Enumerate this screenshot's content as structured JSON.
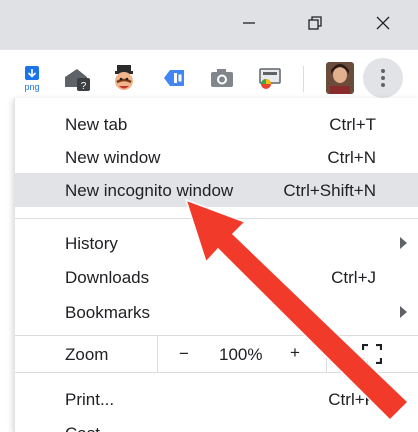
{
  "window_controls": {
    "minimize_icon": "minimize-icon",
    "restore_icon": "restore-icon",
    "close_icon": "close-icon"
  },
  "toolbar": {
    "extensions": [
      {
        "name": "png-download-extension",
        "caption": "png"
      },
      {
        "name": "mail-help-extension",
        "caption": "?"
      },
      {
        "name": "mascot-extension",
        "caption": ""
      },
      {
        "name": "tag-extension",
        "caption": ""
      },
      {
        "name": "camera-extension",
        "caption": ""
      },
      {
        "name": "screen-cast-extension",
        "caption": ""
      }
    ],
    "profile_icon": "profile-avatar",
    "menu_icon": "more-vertical-icon"
  },
  "menu": {
    "new_tab": {
      "label": "New tab",
      "shortcut": "Ctrl+T"
    },
    "new_window": {
      "label": "New window",
      "shortcut": "Ctrl+N"
    },
    "new_incognito": {
      "label": "New incognito window",
      "shortcut": "Ctrl+Shift+N"
    },
    "history": {
      "label": "History"
    },
    "downloads": {
      "label": "Downloads",
      "shortcut": "Ctrl+J"
    },
    "bookmarks": {
      "label": "Bookmarks"
    },
    "zoom": {
      "label": "Zoom",
      "minus": "−",
      "level": "100%",
      "plus": "+"
    },
    "print": {
      "label": "Print...",
      "shortcut": "Ctrl+P"
    },
    "cast": {
      "label": "Cast..."
    }
  },
  "colors": {
    "annotation_arrow": "#f23a2a",
    "highlight": "#e2e3e6",
    "titlebar": "#dfe1e5"
  }
}
